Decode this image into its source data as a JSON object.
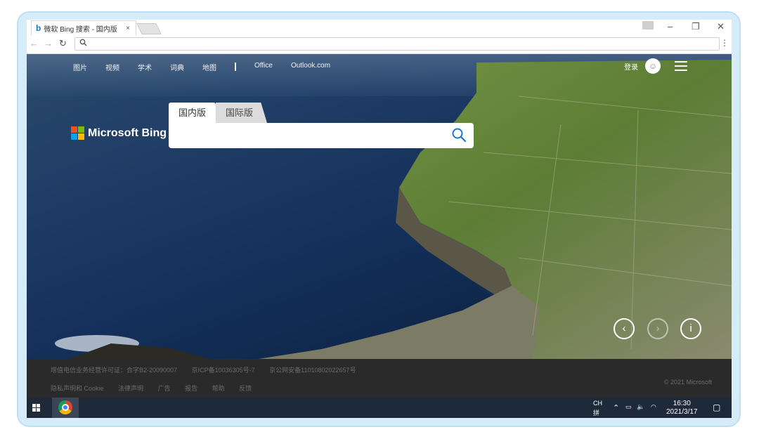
{
  "browser": {
    "tab_title": "微软 Bing 搜索 - 国内版",
    "tab_close": "×",
    "address": "",
    "address_icon": "search-icon"
  },
  "nav": {
    "items": [
      "图片",
      "视频",
      "学术",
      "词典",
      "地图"
    ],
    "links": [
      "Office",
      "Outlook.com"
    ],
    "login": "登录",
    "menu_icon": "hamburger-icon"
  },
  "logo": {
    "text": "Microsoft Bing"
  },
  "search": {
    "tabs": [
      "国内版",
      "国际版"
    ],
    "value": "",
    "placeholder": ""
  },
  "carousel": {
    "prev": "‹",
    "next": "›",
    "info": "i"
  },
  "footer": {
    "line1": [
      "增值电信业务经营许可证：合字B2-20090007",
      "京ICP备10036305号-7",
      "京公网安备11010802022657号"
    ],
    "line2": [
      "隐私声明和 Cookie",
      "法律声明",
      "广告",
      "报告",
      "帮助",
      "反馈"
    ],
    "copyright": "© 2021 Microsoft"
  },
  "taskbar": {
    "ime": "CH",
    "ime2": "拼",
    "time": "16:30",
    "date": "2021/3/17"
  },
  "colors": {
    "accent": "#1678d3",
    "footer_bg": "#2a2a2a",
    "taskbar_bg": "#1e2a3a"
  }
}
